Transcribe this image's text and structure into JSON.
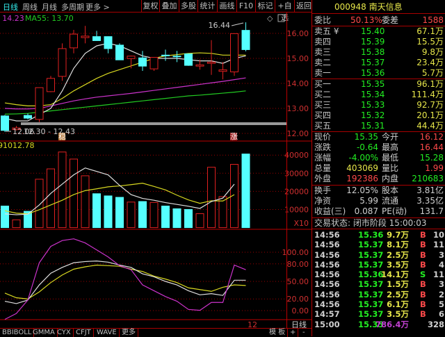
{
  "toolbar": {
    "periods": [
      "日线",
      "周线",
      "月线",
      "多周期",
      "更多 >"
    ],
    "active_period": "日线",
    "buttons": [
      "复权",
      "叠加",
      "多股",
      "统计",
      "画线",
      "F10",
      "标记",
      "+自选",
      "返回"
    ]
  },
  "chart_legend": {
    "ma30_partial": ": 14.23",
    "ma55": "MA55: 13.70",
    "volume_value": "91012.78"
  },
  "annotations": {
    "high_label": "16.44",
    "low_label": "12.06",
    "range_label": "12.30 - 12.43",
    "tag_steady": "稳",
    "tag_rise": "涨"
  },
  "bottom_axis": {
    "day_label": "12",
    "period": "日线"
  },
  "bottom_tabs": [
    "BBIBOLL",
    "GMMA",
    "CYX",
    "CFJT",
    "WAVE",
    "更多"
  ],
  "bottom_right": {
    "template": "模 板",
    "plus": "+",
    "minus": "-"
  },
  "colors": {
    "up": "#e02020",
    "down": "#55ffff",
    "ma5": "#e0e0e0",
    "ma10": "#d8d820",
    "ma30": "#cc33cc",
    "ma55": "#22cc22",
    "grid": "#a00000"
  },
  "chart_data": [
    {
      "type": "candlestick",
      "name": "price",
      "yticks": [
        "16.00",
        "15.00",
        "14.00",
        "13.00",
        "12.00"
      ],
      "ylim": [
        11.8,
        16.8
      ],
      "ohlc": [
        [
          12.7,
          12.74,
          12.06,
          12.12
        ],
        [
          12.15,
          12.3,
          12.12,
          12.22
        ],
        [
          12.72,
          12.8,
          12.56,
          12.61
        ],
        [
          12.56,
          13.83,
          12.45,
          13.83
        ],
        [
          13.67,
          14.3,
          13.65,
          14.2
        ],
        [
          14.28,
          15.6,
          14.1,
          15.39
        ],
        [
          15.42,
          16.14,
          15.2,
          15.97
        ],
        [
          15.83,
          16.3,
          15.6,
          15.89
        ],
        [
          15.87,
          16.1,
          15.7,
          15.71
        ],
        [
          15.87,
          15.88,
          15.2,
          15.39
        ],
        [
          15.53,
          15.6,
          14.94,
          14.94
        ],
        [
          14.99,
          15.11,
          14.6,
          15.09
        ],
        [
          15.02,
          15.3,
          14.5,
          14.69
        ],
        [
          14.58,
          15.04,
          14.5,
          15.04
        ],
        [
          15.13,
          15.35,
          14.9,
          15.12
        ],
        [
          15.09,
          15.3,
          14.85,
          15.07
        ],
        [
          15.18,
          15.2,
          14.7,
          14.72
        ],
        [
          14.69,
          14.95,
          14.55,
          14.74
        ],
        [
          14.8,
          15.73,
          14.34,
          14.85
        ],
        [
          14.48,
          14.85,
          14.16,
          14.54
        ],
        [
          14.46,
          16.0,
          14.3,
          15.99
        ],
        [
          16.12,
          16.44,
          15.28,
          15.35
        ]
      ],
      "ma5": [
        12.6,
        12.5,
        12.5,
        12.75,
        13.0,
        13.7,
        14.6,
        15.2,
        15.5,
        15.6,
        15.5,
        15.3,
        15.1,
        15.0,
        15.0,
        15.0,
        14.95,
        14.9,
        14.9,
        14.8,
        15.0,
        15.1
      ],
      "ma10": [
        13.22,
        13.15,
        13.1,
        13.1,
        13.15,
        13.4,
        13.7,
        13.95,
        14.2,
        14.4,
        14.55,
        14.7,
        14.85,
        15.0,
        15.1,
        15.15,
        15.2,
        15.22,
        15.2,
        15.13,
        15.13,
        15.13
      ],
      "ma30": [
        13.0,
        12.98,
        12.98,
        13.0,
        13.1,
        13.2,
        13.3,
        13.38,
        13.45,
        13.5,
        13.55,
        13.6,
        13.66,
        13.72,
        13.78,
        13.84,
        13.9,
        13.96,
        14.02,
        14.08,
        14.15,
        14.22
      ],
      "ma55": [
        12.77,
        12.78,
        12.8,
        12.85,
        12.9,
        12.95,
        13.0,
        13.05,
        13.1,
        13.15,
        13.2,
        13.25,
        13.3,
        13.35,
        13.4,
        13.45,
        13.5,
        13.53,
        13.57,
        13.61,
        13.65,
        13.7
      ]
    },
    {
      "type": "bar",
      "name": "volume",
      "yticks": [
        "40000",
        "30000",
        "20000",
        "10000"
      ],
      "unit_label": "X10",
      "values": [
        11900,
        4300,
        9000,
        26700,
        32400,
        41700,
        37800,
        28600,
        18700,
        17500,
        16700,
        14100,
        14400,
        13900,
        11900,
        10400,
        10000,
        7700,
        33300,
        17100,
        34900,
        40600
      ],
      "ma5": [
        7600,
        7100,
        7400,
        12500,
        18900,
        24000,
        29100,
        32900,
        31000,
        29100,
        23300,
        18200,
        16100,
        15100,
        13800,
        12800,
        11800,
        10600,
        14400,
        16300,
        24000,
        null
      ],
      "ma10": [
        9300,
        8000,
        7600,
        9900,
        12500,
        15100,
        18200,
        20400,
        21400,
        22500,
        23000,
        23700,
        24500,
        22700,
        20800,
        17900,
        15300,
        13400,
        14800,
        14700,
        18200,
        null
      ]
    },
    {
      "type": "line",
      "name": "kdj",
      "yticks": [
        "100.00",
        "80.00",
        "50.00",
        "20.00",
        "0.00"
      ],
      "k": [
        16,
        12,
        18,
        44,
        64,
        74,
        82,
        84,
        85,
        83,
        78,
        74,
        63,
        58,
        50,
        44,
        34,
        27,
        29,
        26,
        52,
        52
      ],
      "d": [
        30,
        22,
        20,
        32,
        48,
        61,
        71,
        75,
        78,
        77,
        76,
        71,
        67,
        59,
        54,
        48,
        39,
        36,
        33,
        40,
        44,
        43
      ],
      "j": [
        -15,
        -5,
        18,
        82,
        110,
        120,
        123,
        116,
        104,
        92,
        77,
        70,
        44,
        34,
        24,
        16,
        2,
        0.5,
        14,
        14,
        78,
        70
      ]
    }
  ],
  "quote": {
    "code": "000948",
    "name": "南天信息",
    "weibi_label": "委比",
    "weibi": "50.13%",
    "weicha_label": "委差",
    "weicha": "1588",
    "asks": [
      {
        "label": "卖五 ¥",
        "price": "15.40",
        "vol": "67.1万"
      },
      {
        "label": "卖四",
        "price": "15.39",
        "vol": "15.5万"
      },
      {
        "label": "卖三",
        "price": "15.38",
        "vol": "9.8万"
      },
      {
        "label": "卖二",
        "price": "15.37",
        "vol": "23.4万"
      },
      {
        "label": "卖一",
        "price": "15.36",
        "vol": "5.7万"
      }
    ],
    "bids": [
      {
        "label": "买一",
        "price": "15.35",
        "vol": "96.1万"
      },
      {
        "label": "买二",
        "price": "15.34",
        "vol": "111.4万"
      },
      {
        "label": "买三",
        "price": "15.33",
        "vol": "92.7万"
      },
      {
        "label": "买四",
        "price": "15.32",
        "vol": "20.1万"
      },
      {
        "label": "买五",
        "price": "15.31",
        "vol": "44.4万"
      }
    ],
    "stats": [
      {
        "l1": "现价",
        "v1": "15.35",
        "c1": "g",
        "l2": "今开",
        "v2": "16.12",
        "c2": "r"
      },
      {
        "l1": "涨跌",
        "v1": "-0.64",
        "c1": "g",
        "l2": "最高",
        "v2": "16.44",
        "c2": "r"
      },
      {
        "l1": "涨幅",
        "v1": "-4.00%",
        "c1": "g",
        "l2": "最低",
        "v2": "15.28",
        "c2": "g"
      },
      {
        "l1": "总量",
        "v1": "403069",
        "c1": "y",
        "l2": "量比",
        "v2": "1.99",
        "c2": "r"
      },
      {
        "l1": "外盘",
        "v1": "192386",
        "c1": "r",
        "l2": "内盘",
        "v2": "210683",
        "c2": "g"
      }
    ],
    "fundamentals": [
      {
        "l1": "换手",
        "v1": "12.05%",
        "l2": "股本",
        "v2": "3.81亿"
      },
      {
        "l1": "净资",
        "v1": "5.99",
        "l2": "流通",
        "v2": "3.35亿"
      },
      {
        "l1": "收益(三)",
        "v1": "0.087",
        "l2": "PE(动)",
        "v2": "131.7"
      }
    ],
    "trade_status": "交易状态: 闭市阶段 15:00:03",
    "ticks": [
      {
        "time": "14:56",
        "price": "15.36",
        "vol": "9.7万",
        "side": "B",
        "n": "10"
      },
      {
        "time": "14:56",
        "price": "15.37",
        "vol": "8.1万",
        "side": "B",
        "n": "11"
      },
      {
        "time": "14:56",
        "price": "15.37",
        "vol": "2.5万",
        "side": "B",
        "n": "3"
      },
      {
        "time": "14:56",
        "price": "15.37",
        "vol": "3.5万",
        "side": "B",
        "n": "4"
      },
      {
        "time": "14:56",
        "price": "15.36",
        "vol": "14.1万",
        "side": "S",
        "n": "11"
      },
      {
        "time": "14:56",
        "price": "15.37",
        "vol": "1.5万",
        "side": "B",
        "n": "3"
      },
      {
        "time": "14:56",
        "price": "15.37",
        "vol": "2.5万",
        "side": "B",
        "n": "2"
      },
      {
        "time": "14:56",
        "price": "15.37",
        "vol": "6.1万",
        "side": "B",
        "n": "5"
      },
      {
        "time": "14:57",
        "price": "15.37",
        "vol": "3.5万",
        "side": "B",
        "n": "6"
      },
      {
        "time": "15:00",
        "price": "15.35",
        "vol": "786.4万",
        "side": "",
        "n": "328"
      }
    ]
  }
}
